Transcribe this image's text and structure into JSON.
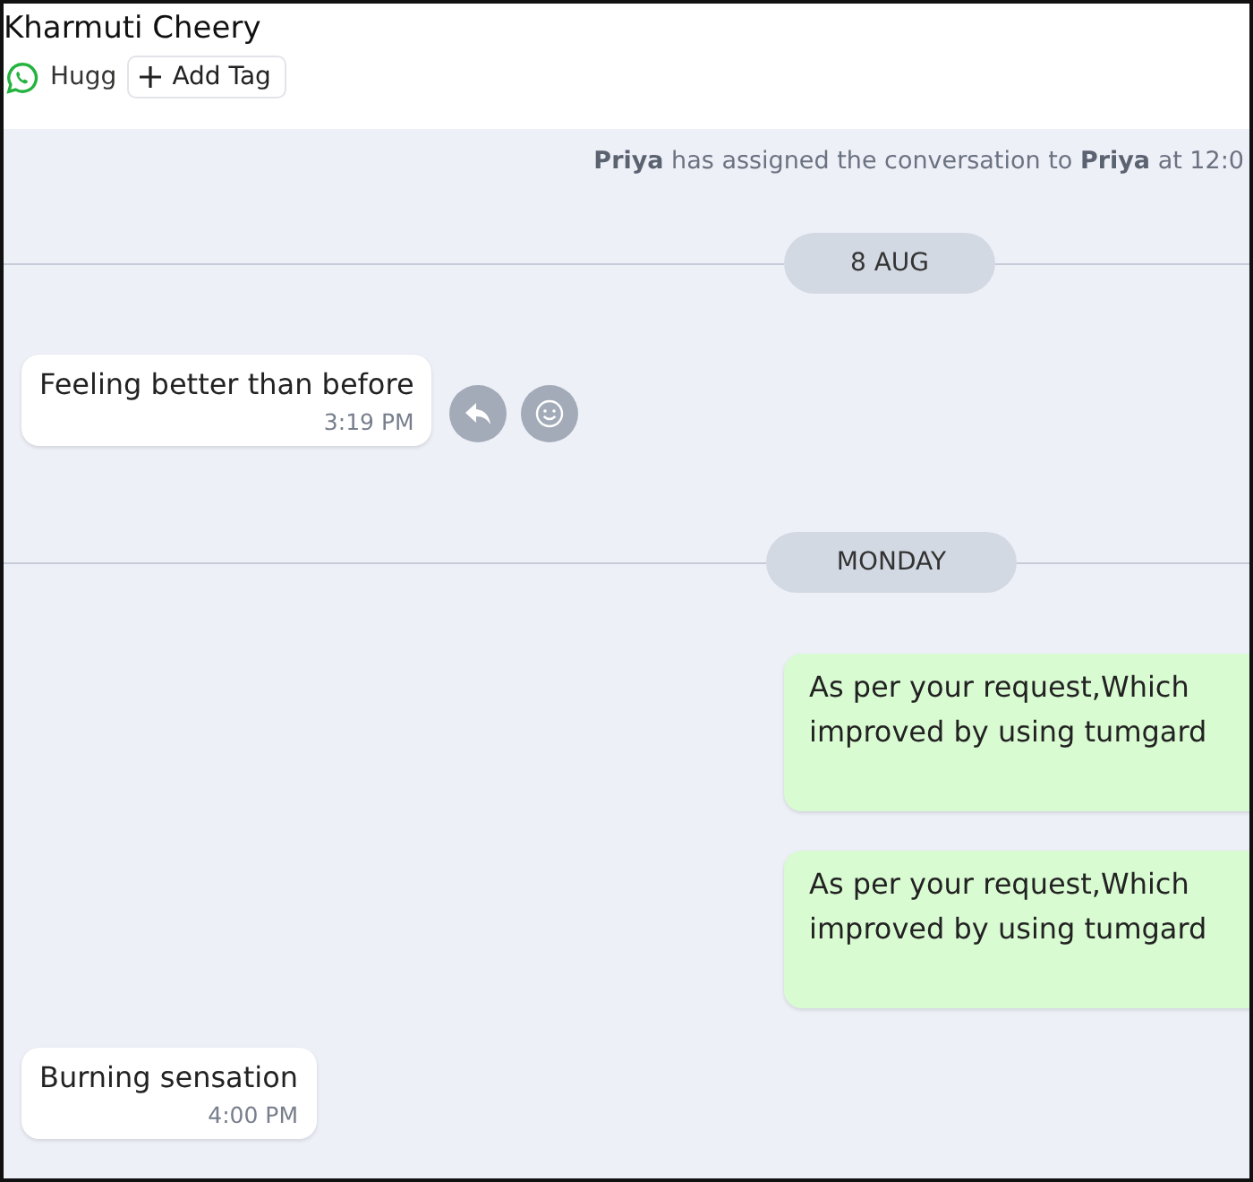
{
  "contact": {
    "name": "Kharmuti Cheery",
    "label": "Hugg",
    "add_tag": "Add Tag"
  },
  "messages": [
    {
      "kind": "system",
      "text": "**Priya** has assigned the conversation to **Priya** at 12:0"
    },
    {
      "kind": "date",
      "text": "8 AUG"
    },
    {
      "kind": "incoming",
      "lines": [
        "Feeling better than before"
      ],
      "time": "3:19 PM",
      "actions": true
    },
    {
      "kind": "date",
      "text": "MONDAY"
    },
    {
      "kind": "outgoing",
      "lines": [
        "As per your request,Which",
        "improved by using tumgard"
      ]
    },
    {
      "kind": "outgoing",
      "lines": [
        "As per your request,Which",
        "improved by using tumgard"
      ]
    },
    {
      "kind": "incoming",
      "lines": [
        "Burning sensation"
      ],
      "time": "4:00 PM",
      "actions": false
    }
  ]
}
